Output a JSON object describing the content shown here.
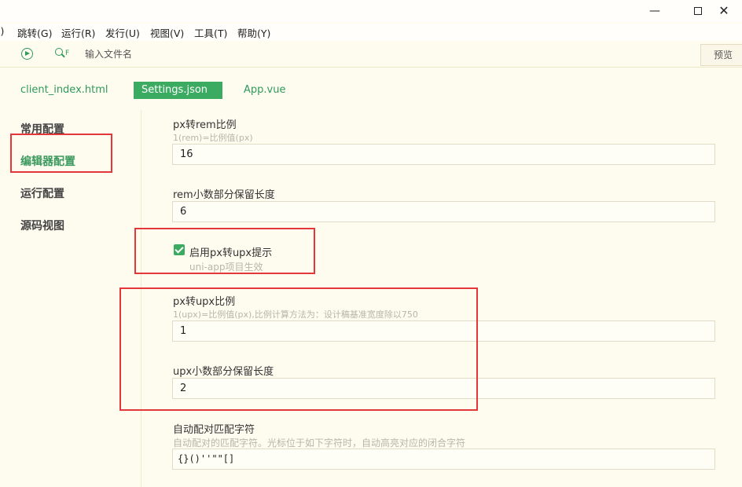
{
  "window": {
    "minimize": "—",
    "maximize": "",
    "close": "✕"
  },
  "menu": [
    "l)",
    "跳转(G)",
    "运行(R)",
    "发行(U)",
    "视图(V)",
    "工具(T)",
    "帮助(Y)"
  ],
  "toolbar": {
    "search_placeholder": "输入文件名",
    "search_icon_suffix": "F",
    "preview_label": "预览"
  },
  "tabs": [
    {
      "label": "client_index.html",
      "active": false
    },
    {
      "label": "Settings.json",
      "active": true
    },
    {
      "label": "App.vue",
      "active": false
    }
  ],
  "sidebar": {
    "items": [
      {
        "label": "常用配置",
        "active": false
      },
      {
        "label": "编辑器配置",
        "active": true
      },
      {
        "label": "运行配置",
        "active": false
      },
      {
        "label": "源码视图",
        "active": false
      }
    ]
  },
  "settings": {
    "px_rem": {
      "label": "px转rem比例",
      "hint": "1(rem)=比例值(px)",
      "value": "16"
    },
    "rem_decimal": {
      "label": "rem小数部分保留长度",
      "value": "6"
    },
    "px_upx_hint": {
      "label": "启用px转upx提示",
      "hint": "uni-app项目生效",
      "checked": true
    },
    "px_upx": {
      "label": "px转upx比例",
      "hint": "1(upx)=比例值(px),比例计算方法为：设计稿基准宽度除以750",
      "value": "1"
    },
    "upx_decimal": {
      "label": "upx小数部分保留长度",
      "value": "2"
    },
    "auto_pair": {
      "label": "自动配对匹配字符",
      "hint": "自动配对的匹配字符。光标位于如下字符时，自动高亮对应的闭合字符",
      "value": "{}()''\"\"[]"
    }
  },
  "colors": {
    "accent": "#3cab62",
    "highlight": "#e5373a",
    "background": "#fefbef"
  }
}
